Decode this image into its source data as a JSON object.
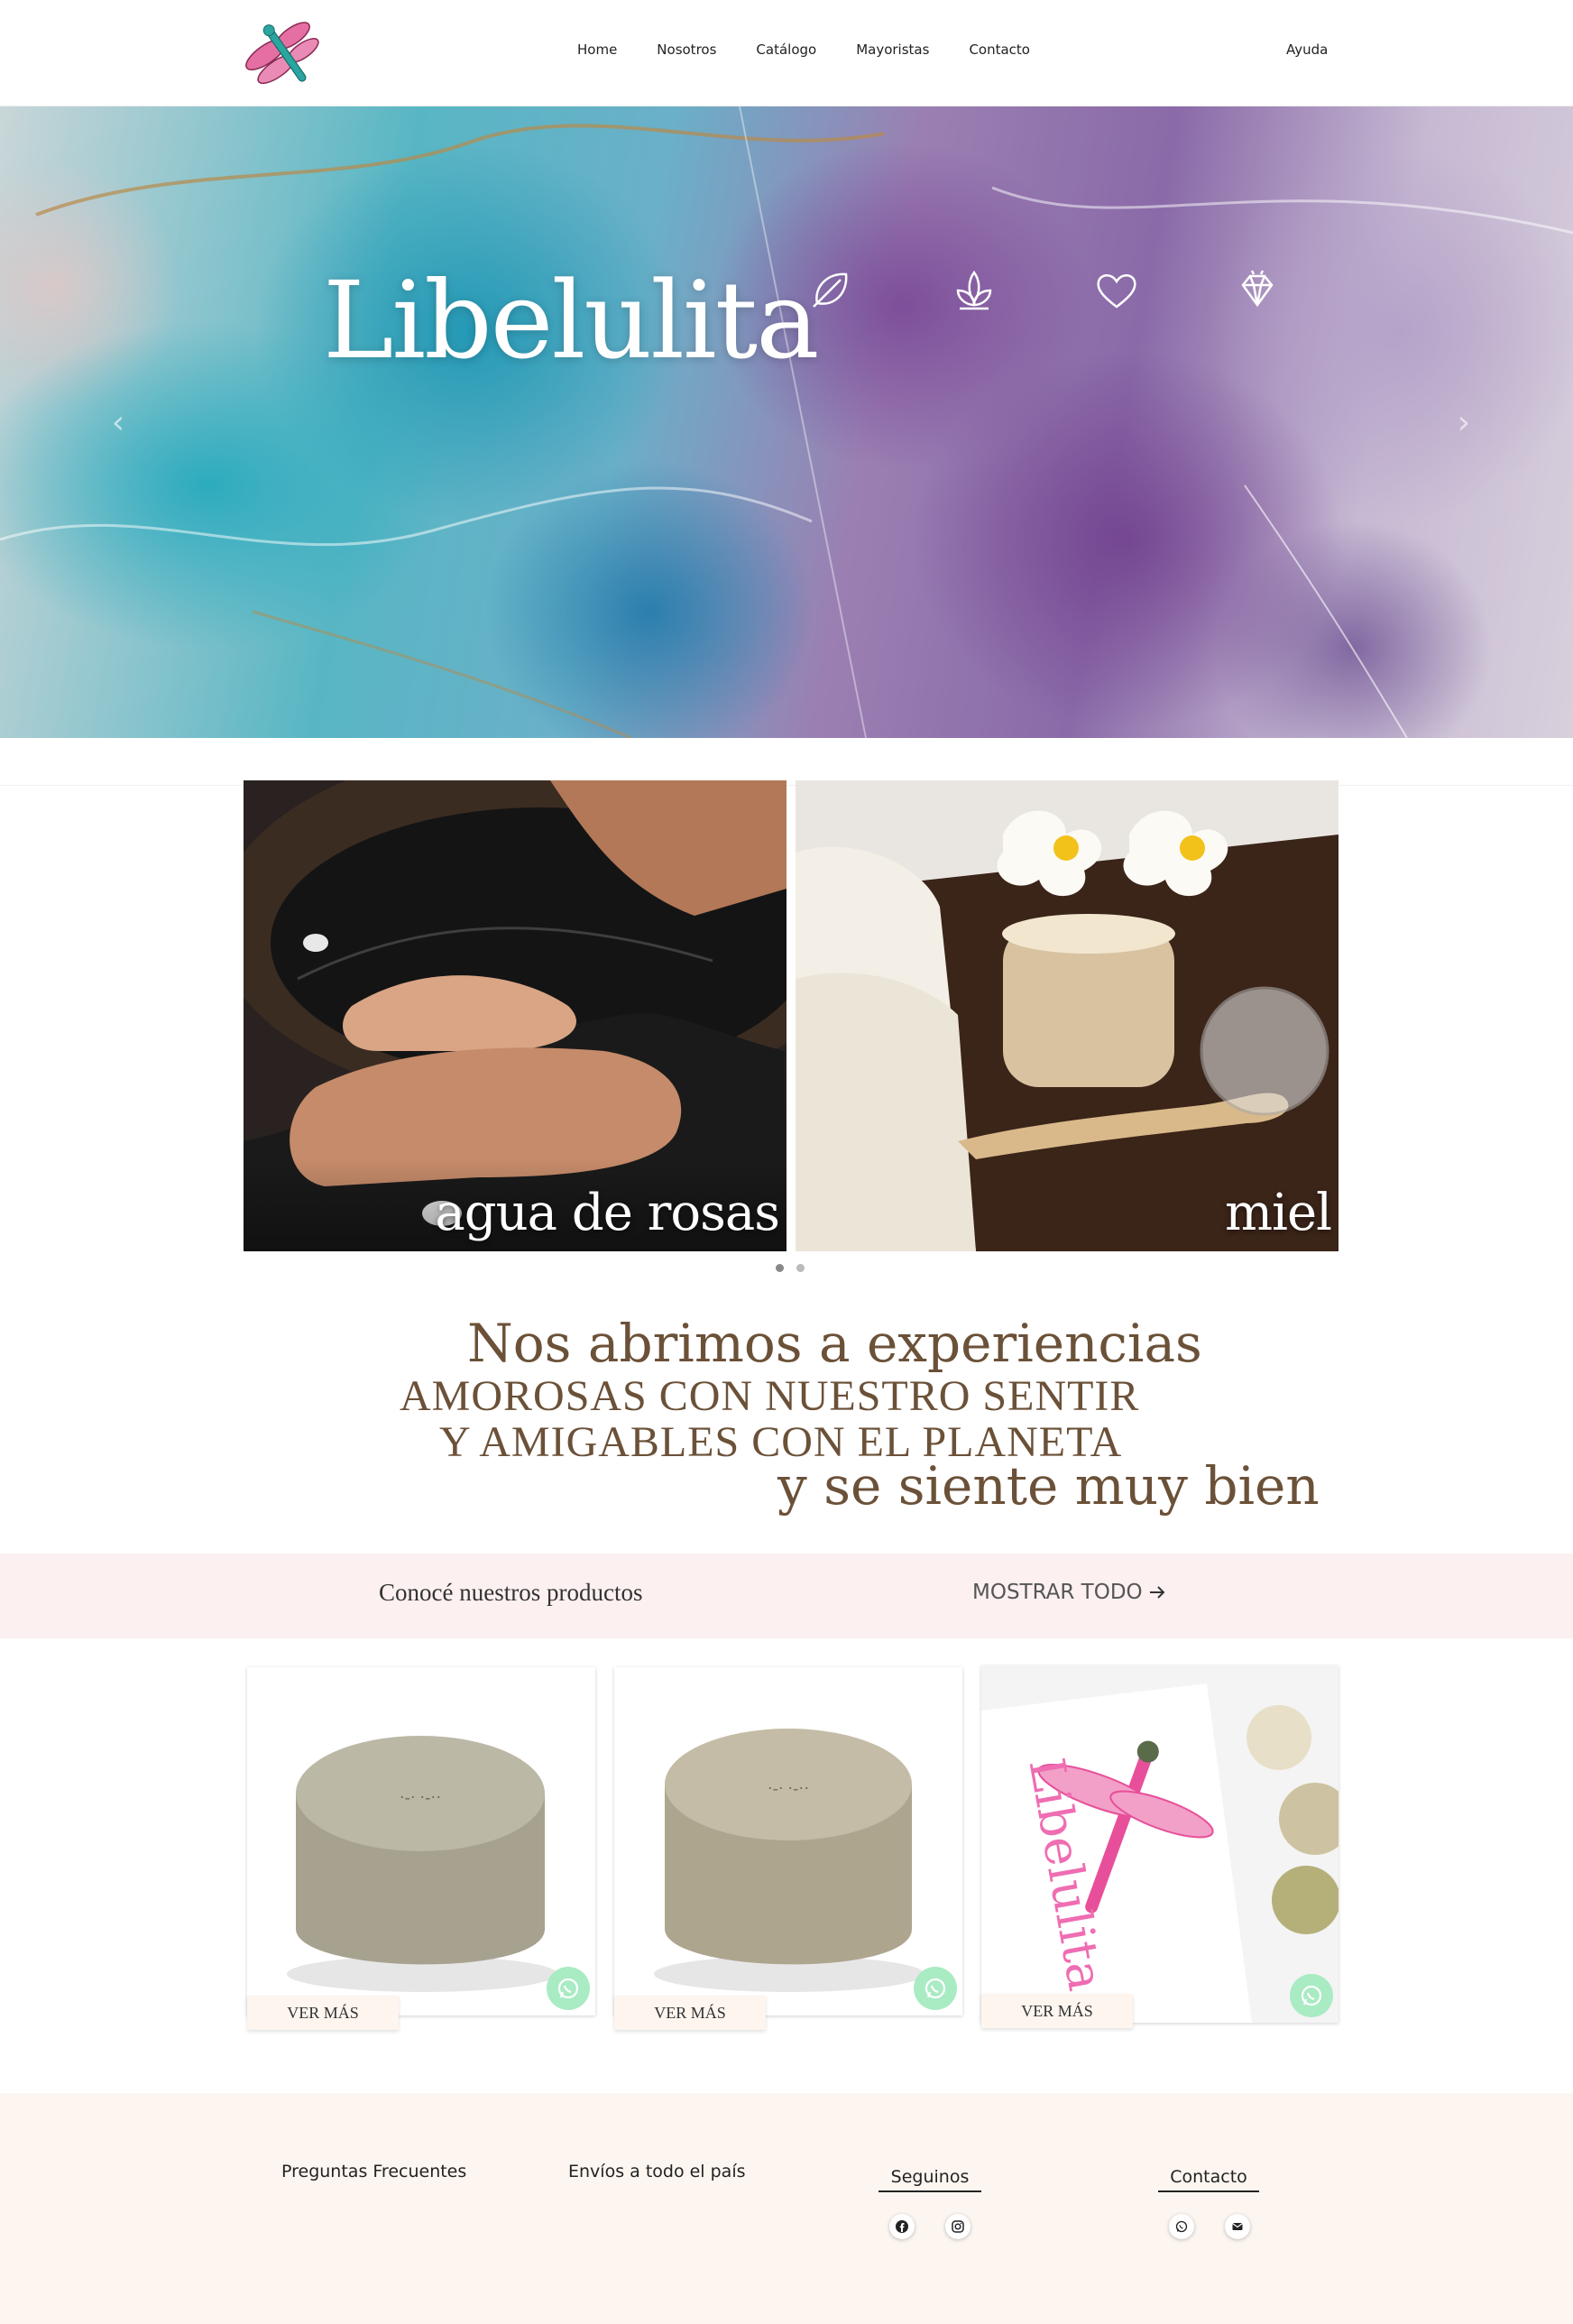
{
  "nav": {
    "links": [
      "Home",
      "Nosotros",
      "Catálogo",
      "Mayoristas",
      "Contacto"
    ],
    "help": "Ayuda"
  },
  "hero": {
    "title": "Libelulita",
    "icons": [
      "feather-icon",
      "sprout-icon",
      "heart-icon",
      "diamond-icon"
    ]
  },
  "features": [
    {
      "label": "agua de rosas"
    },
    {
      "label": "miel"
    }
  ],
  "tagline": {
    "line1": "Nos abrimos a experiencias",
    "line2": "AMOROSAS CON NUESTRO SENTIR",
    "line3": "Y AMIGABLES CON EL PLANETA",
    "line4": "y se siente muy bien"
  },
  "products_bar": {
    "title": "Conocé nuestros productos",
    "show_all": "MOSTRAR TODO"
  },
  "products": [
    {
      "button": "VER MÁS"
    },
    {
      "button": "VER MÁS"
    },
    {
      "button": "VER MÁS",
      "bag_text": "Libelulita"
    }
  ],
  "footer": {
    "faq": "Preguntas Frecuentes",
    "shipping": "Envíos a todo el país",
    "follow": "Seguinos",
    "contact": "Contacto"
  },
  "colors": {
    "accent_brown": "#6b5138",
    "products_bar_bg": "#fdf0f0",
    "footer_bg": "#fdf6f0",
    "whatsapp_green": "#a9ebc3"
  }
}
